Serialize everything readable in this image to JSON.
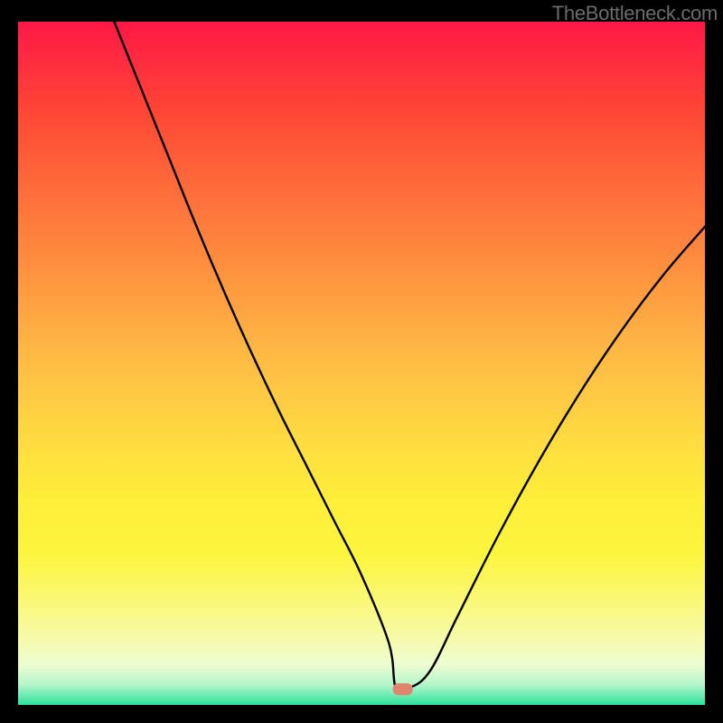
{
  "watermark": "TheBottleneck.com",
  "chart_data": {
    "type": "line",
    "title": "",
    "xlabel": "",
    "ylabel": "",
    "xlim": [
      0,
      100
    ],
    "ylim": [
      0,
      100
    ],
    "grid": false,
    "legend": false,
    "series": [
      {
        "name": "bottleneck-curve",
        "x": [
          14,
          18,
          22,
          26,
          30,
          34,
          38,
          42,
          46,
          50,
          54,
          55,
          57,
          60,
          64,
          70,
          76,
          82,
          88,
          94,
          100
        ],
        "y": [
          100,
          90,
          80,
          70,
          60.5,
          51.5,
          43,
          35,
          27,
          19,
          9,
          2.5,
          2.5,
          5,
          13,
          25,
          36,
          46,
          55,
          63,
          70
        ]
      }
    ],
    "marker": {
      "x": 56,
      "y": 2.3,
      "color": "#e0846d"
    }
  }
}
